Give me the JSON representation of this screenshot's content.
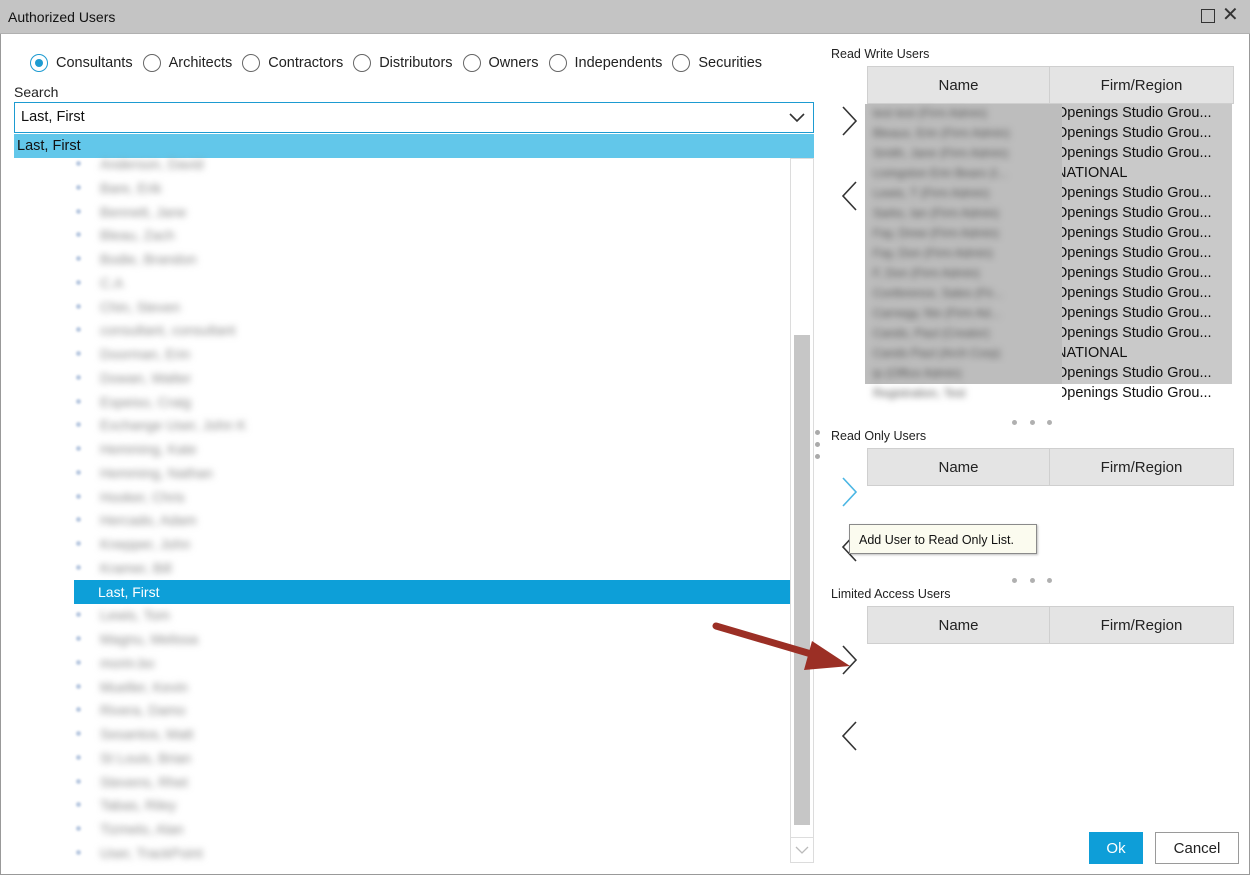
{
  "window": {
    "title": "Authorized Users"
  },
  "user_types": [
    {
      "label": "Consultants",
      "checked": true
    },
    {
      "label": "Architects",
      "checked": false
    },
    {
      "label": "Contractors",
      "checked": false
    },
    {
      "label": "Distributors",
      "checked": false
    },
    {
      "label": "Owners",
      "checked": false
    },
    {
      "label": "Independents",
      "checked": false
    },
    {
      "label": "Securities",
      "checked": false
    }
  ],
  "search": {
    "label": "Search",
    "value": "Last, First",
    "highlighted_option": "Last, First"
  },
  "dropdown_items": [
    "Anderson, David",
    "Bare, Erik",
    "Bennett, Jane",
    "Bleau, Zach",
    "Bodie, Brandon",
    "C.A",
    "Chin, Steven",
    "consultant, consultant",
    "Doorman, Erin",
    "Dowan, Walter",
    "Espeiso, Craig",
    "Exchange User, John K",
    "Hemming, Kate",
    "Hemming, Nathan",
    "Hooker, Chris",
    "Hercado, Adam",
    "Knepper, John",
    "Kramer, Bill",
    "Last, First",
    "Lewis, Tom",
    "Magnu, Melissa",
    "morin.bo",
    "Mueller, Kevin",
    "Rivera, Damo",
    "Sesantos, Matt",
    "St Louis, Brian",
    "Stevens, Rhet",
    "Tabas, Riley",
    "Tizmelo, Alan",
    "User, TrackPoint"
  ],
  "dropdown_active_index": 18,
  "read_write": {
    "title": "Read Write Users",
    "columns": [
      "Name",
      "Firm/Region"
    ],
    "rows": [
      {
        "name": "test test (Firm Admin)",
        "firm": "Openings Studio Grou..."
      },
      {
        "name": "Bleaux, Erin (Firm Admin)",
        "firm": "Openings Studio Grou..."
      },
      {
        "name": "Smith, Jane (Firm Admin)",
        "firm": "Openings Studio Grou..."
      },
      {
        "name": "Livingston Erin Bears (I...",
        "firm": "NATIONAL"
      },
      {
        "name": "Lewis, T (Firm Admin)",
        "firm": "Openings Studio Grou..."
      },
      {
        "name": "Sarks, Ian (Firm Admin)",
        "firm": "Openings Studio Grou..."
      },
      {
        "name": "Fay, Drew (Firm Admin)",
        "firm": "Openings Studio Grou..."
      },
      {
        "name": "Fay, Don (Firm Admin)",
        "firm": "Openings Studio Grou..."
      },
      {
        "name": "F, Don (Firm Admin)",
        "firm": "Openings Studio Grou..."
      },
      {
        "name": "Conference, Sales (Fir...",
        "firm": "Openings Studio Grou..."
      },
      {
        "name": "Carnegy, Nix (Firm Ad...",
        "firm": "Openings Studio Grou..."
      },
      {
        "name": "Cands, Paul (Creator)",
        "firm": "Openings Studio Grou..."
      },
      {
        "name": "Cands Paul (Arch Corp)",
        "firm": "NATIONAL"
      },
      {
        "name": "ip (Office Admin)",
        "firm": "Openings Studio Grou..."
      },
      {
        "name": "Registration, Test",
        "firm": "Openings Studio Grou..."
      }
    ]
  },
  "read_only": {
    "title": "Read Only Users",
    "columns": [
      "Name",
      "Firm/Region"
    ],
    "tooltip": "Add User to Read Only List."
  },
  "limited_access": {
    "title": "Limited Access Users",
    "columns": [
      "Name",
      "Firm/Region"
    ]
  },
  "buttons": {
    "ok": "Ok",
    "cancel": "Cancel"
  },
  "colors": {
    "accent": "#0e9ed8",
    "highlight": "#62c7ea",
    "annotation_arrow": "#9b2f25"
  }
}
